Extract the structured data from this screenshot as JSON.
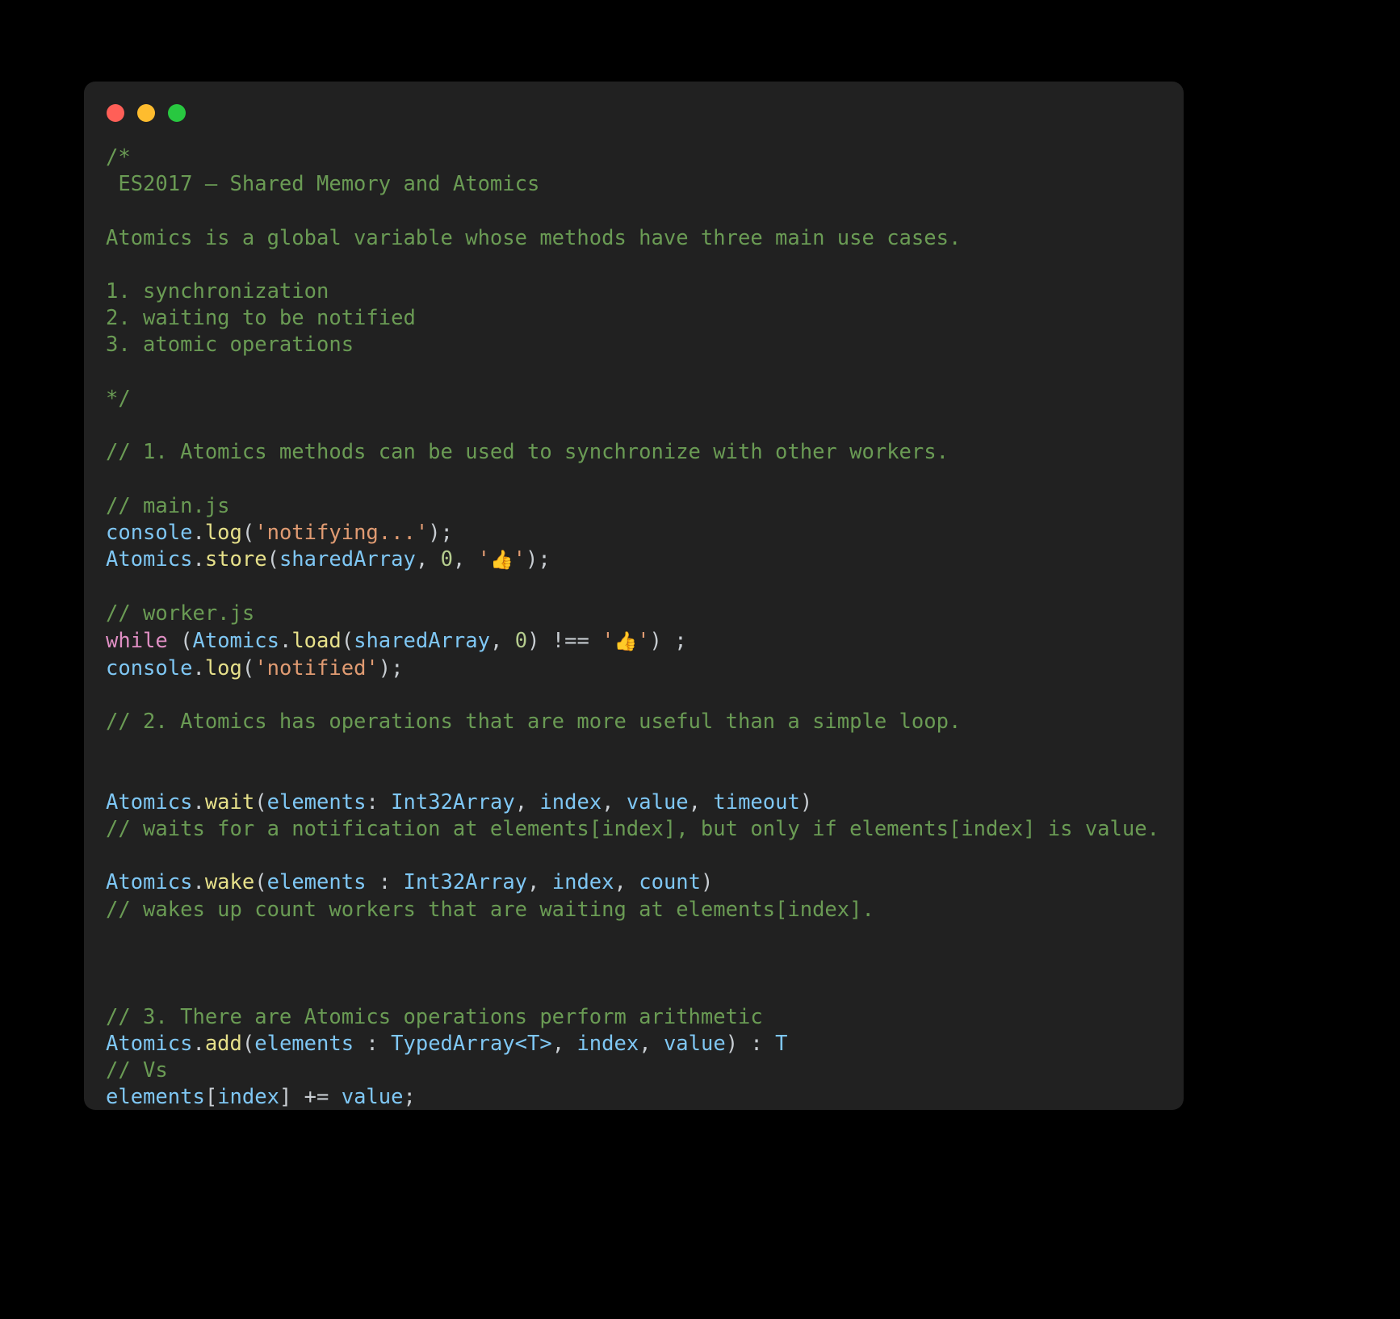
{
  "window": {
    "title": "ES2017 – Shared Memory and Atomics",
    "background_color": "#212121",
    "page_background_color": "#000000",
    "traffic_lights": [
      {
        "name": "close",
        "color": "#ff5f57"
      },
      {
        "name": "minimize",
        "color": "#febc2e"
      },
      {
        "name": "maximize",
        "color": "#28c840"
      }
    ]
  },
  "theme": {
    "comment": "#6a9b54",
    "identifier": "#7fc7f4",
    "function": "#e6e08a",
    "string": "#e09b72",
    "number": "#b5cc8e",
    "keyword": "#e08fc4",
    "punctuation": "#c8cdd2"
  },
  "code": {
    "language": "javascript",
    "lines": [
      "/*",
      " ES2017 – Shared Memory and Atomics",
      "",
      "Atomics is a global variable whose methods have three main use cases.",
      "",
      "1. synchronization",
      "2. waiting to be notified",
      "3. atomic operations",
      "",
      "*/",
      "",
      "// 1. Atomics methods can be used to synchronize with other workers.",
      "",
      "// main.js",
      "console.log('notifying...');",
      "Atomics.store(sharedArray, 0, '👍');",
      "",
      "// worker.js",
      "while (Atomics.load(sharedArray, 0) !== '👍') ;",
      "console.log('notified');",
      "",
      "// 2. Atomics has operations that are more useful than a simple loop.",
      "",
      "",
      "Atomics.wait(elements: Int32Array, index, value, timeout)",
      "// waits for a notification at elements[index], but only if elements[index] is value.",
      "",
      "Atomics.wake(elements : Int32Array, index, count)",
      "// wakes up count workers that are waiting at elements[index].",
      "",
      "",
      "",
      "// 3. There are Atomics operations perform arithmetic",
      "Atomics.add(elements : TypedArray<T>, index, value) : T",
      "// Vs",
      "elements[index] += value;"
    ],
    "tokens": [
      [
        {
          "t": "/*",
          "c": "comment"
        }
      ],
      [
        {
          "t": " ES2017 – Shared Memory and Atomics",
          "c": "comment"
        }
      ],
      [],
      [
        {
          "t": "Atomics is a global variable whose methods have three main use cases.",
          "c": "comment"
        }
      ],
      [],
      [
        {
          "t": "1. synchronization",
          "c": "comment"
        }
      ],
      [
        {
          "t": "2. waiting to be notified",
          "c": "comment"
        }
      ],
      [
        {
          "t": "3. atomic operations",
          "c": "comment"
        }
      ],
      [],
      [
        {
          "t": "*/",
          "c": "comment"
        }
      ],
      [],
      [
        {
          "t": "// 1. Atomics methods can be used to synchronize with other workers.",
          "c": "comment"
        }
      ],
      [],
      [
        {
          "t": "// main.js",
          "c": "comment"
        }
      ],
      [
        {
          "t": "console",
          "c": "ident"
        },
        {
          "t": ".",
          "c": "punct"
        },
        {
          "t": "log",
          "c": "func"
        },
        {
          "t": "(",
          "c": "punct"
        },
        {
          "t": "'notifying...'",
          "c": "string"
        },
        {
          "t": ");",
          "c": "punct"
        }
      ],
      [
        {
          "t": "Atomics",
          "c": "ident"
        },
        {
          "t": ".",
          "c": "punct"
        },
        {
          "t": "store",
          "c": "func"
        },
        {
          "t": "(",
          "c": "punct"
        },
        {
          "t": "sharedArray",
          "c": "ident"
        },
        {
          "t": ", ",
          "c": "punct"
        },
        {
          "t": "0",
          "c": "number"
        },
        {
          "t": ", ",
          "c": "punct"
        },
        {
          "t": "'",
          "c": "string"
        },
        {
          "t": "👍",
          "c": "emoji"
        },
        {
          "t": "'",
          "c": "string"
        },
        {
          "t": ");",
          "c": "punct"
        }
      ],
      [],
      [
        {
          "t": "// worker.js",
          "c": "comment"
        }
      ],
      [
        {
          "t": "while",
          "c": "kw"
        },
        {
          "t": " (",
          "c": "punct"
        },
        {
          "t": "Atomics",
          "c": "ident"
        },
        {
          "t": ".",
          "c": "punct"
        },
        {
          "t": "load",
          "c": "func"
        },
        {
          "t": "(",
          "c": "punct"
        },
        {
          "t": "sharedArray",
          "c": "ident"
        },
        {
          "t": ", ",
          "c": "punct"
        },
        {
          "t": "0",
          "c": "number"
        },
        {
          "t": ") !== ",
          "c": "punct"
        },
        {
          "t": "'",
          "c": "string"
        },
        {
          "t": "👍",
          "c": "emoji"
        },
        {
          "t": "'",
          "c": "string"
        },
        {
          "t": ") ;",
          "c": "punct"
        }
      ],
      [
        {
          "t": "console",
          "c": "ident"
        },
        {
          "t": ".",
          "c": "punct"
        },
        {
          "t": "log",
          "c": "func"
        },
        {
          "t": "(",
          "c": "punct"
        },
        {
          "t": "'notified'",
          "c": "string"
        },
        {
          "t": ");",
          "c": "punct"
        }
      ],
      [],
      [
        {
          "t": "// 2. Atomics has operations that are more useful than a simple loop.",
          "c": "comment"
        }
      ],
      [],
      [],
      [
        {
          "t": "Atomics",
          "c": "ident"
        },
        {
          "t": ".",
          "c": "punct"
        },
        {
          "t": "wait",
          "c": "func"
        },
        {
          "t": "(",
          "c": "punct"
        },
        {
          "t": "elements",
          "c": "ident"
        },
        {
          "t": ": ",
          "c": "punct"
        },
        {
          "t": "Int32Array",
          "c": "ident"
        },
        {
          "t": ", ",
          "c": "punct"
        },
        {
          "t": "index",
          "c": "ident"
        },
        {
          "t": ", ",
          "c": "punct"
        },
        {
          "t": "value",
          "c": "ident"
        },
        {
          "t": ", ",
          "c": "punct"
        },
        {
          "t": "timeout",
          "c": "ident"
        },
        {
          "t": ")",
          "c": "punct"
        }
      ],
      [
        {
          "t": "// waits for a notification at elements[index], but only if elements[index] is value.",
          "c": "comment"
        }
      ],
      [],
      [
        {
          "t": "Atomics",
          "c": "ident"
        },
        {
          "t": ".",
          "c": "punct"
        },
        {
          "t": "wake",
          "c": "func"
        },
        {
          "t": "(",
          "c": "punct"
        },
        {
          "t": "elements",
          "c": "ident"
        },
        {
          "t": " : ",
          "c": "punct"
        },
        {
          "t": "Int32Array",
          "c": "ident"
        },
        {
          "t": ", ",
          "c": "punct"
        },
        {
          "t": "index",
          "c": "ident"
        },
        {
          "t": ", ",
          "c": "punct"
        },
        {
          "t": "count",
          "c": "ident"
        },
        {
          "t": ")",
          "c": "punct"
        }
      ],
      [
        {
          "t": "// wakes up count workers that are waiting at elements[index].",
          "c": "comment"
        }
      ],
      [],
      [],
      [],
      [
        {
          "t": "// 3. There are Atomics operations perform arithmetic",
          "c": "comment"
        }
      ],
      [
        {
          "t": "Atomics",
          "c": "ident"
        },
        {
          "t": ".",
          "c": "punct"
        },
        {
          "t": "add",
          "c": "func"
        },
        {
          "t": "(",
          "c": "punct"
        },
        {
          "t": "elements",
          "c": "ident"
        },
        {
          "t": " : ",
          "c": "punct"
        },
        {
          "t": "TypedArray<T>",
          "c": "ident"
        },
        {
          "t": ", ",
          "c": "punct"
        },
        {
          "t": "index",
          "c": "ident"
        },
        {
          "t": ", ",
          "c": "punct"
        },
        {
          "t": "value",
          "c": "ident"
        },
        {
          "t": ") : ",
          "c": "punct"
        },
        {
          "t": "T",
          "c": "ident"
        }
      ],
      [
        {
          "t": "// Vs",
          "c": "comment"
        }
      ],
      [
        {
          "t": "elements",
          "c": "ident"
        },
        {
          "t": "[",
          "c": "punct"
        },
        {
          "t": "index",
          "c": "ident"
        },
        {
          "t": "] += ",
          "c": "punct"
        },
        {
          "t": "value",
          "c": "ident"
        },
        {
          "t": ";",
          "c": "punct"
        }
      ]
    ]
  }
}
